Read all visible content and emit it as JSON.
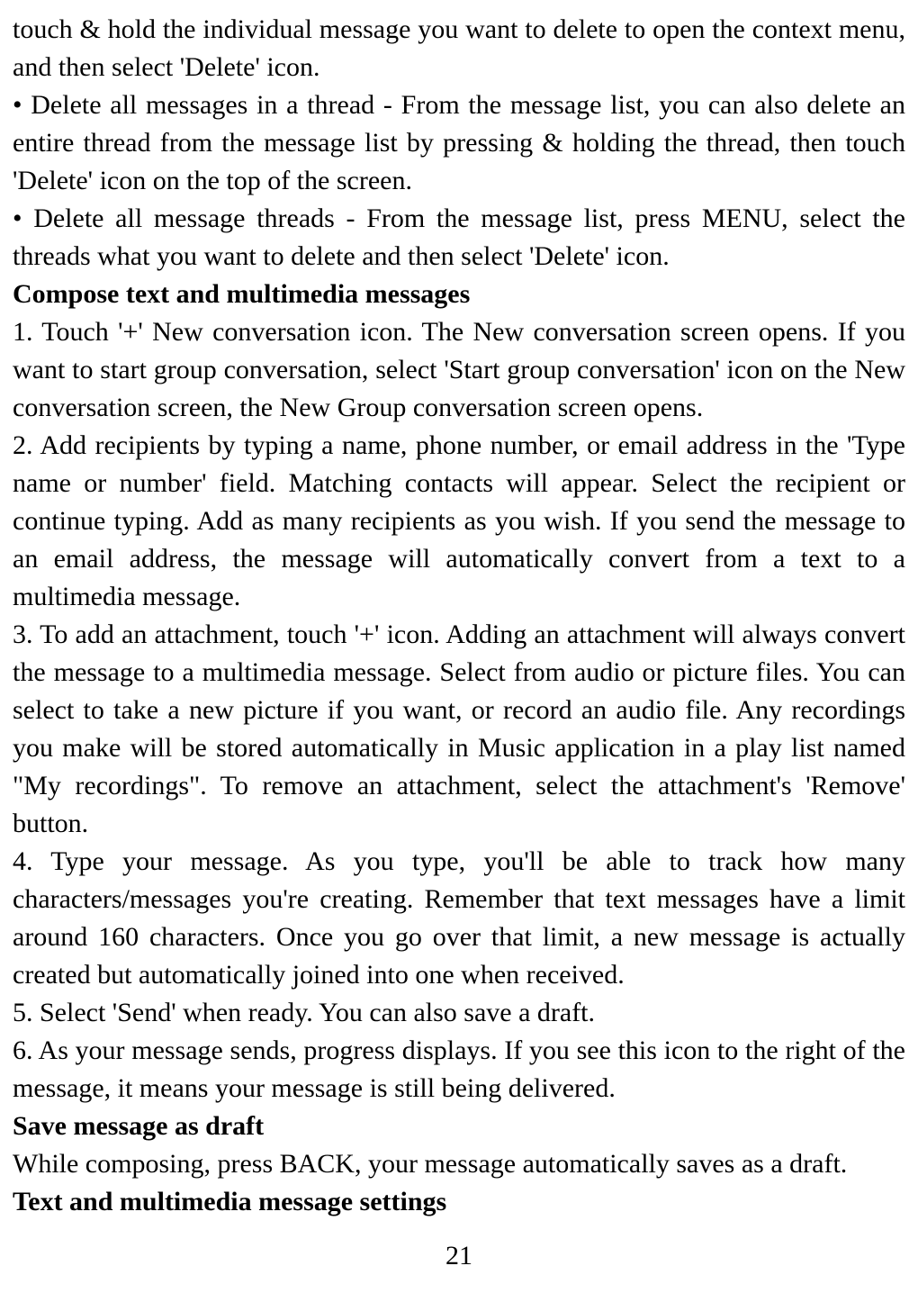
{
  "content": {
    "p1": "touch & hold the individual message you want to delete to open the context menu, and then select 'Delete' icon.",
    "p2": "• Delete all messages in a thread - From the message list, you can also delete an entire thread from the message list by pressing & holding the thread, then touch 'Delete' icon on the top of the screen.",
    "p3": "• Delete all message threads - From the message list, press MENU, select the threads what you want to delete and then select 'Delete' icon.",
    "h1": "Compose text and multimedia messages",
    "p4": "1. Touch '+' New conversation icon. The New conversation screen opens. If you want to start group conversation, select 'Start group conversation' icon on the New conversation screen, the New Group conversation screen opens.",
    "p5": "2. Add recipients by typing a name, phone number, or email address in the 'Type name or number' field. Matching contacts will appear. Select the recipient or continue typing. Add as many recipients as you wish. If you send the message to an email address, the message will automatically convert from a text to a multimedia message.",
    "p6": "3. To add an attachment, touch '+' icon. Adding an attachment will always convert the message to a multimedia message. Select from audio or picture files. You can select to take a new picture if you want, or record an audio file. Any recordings you make will be stored automatically in Music application in a play list named \"My recordings\". To remove an attachment, select the attachment's 'Remove' button.",
    "p7": "4. Type your message. As you type, you'll be able to track how many characters/messages you're creating. Remember that text messages have a limit around 160 characters. Once you go over that limit, a new message is actually created but automatically joined into one when received.",
    "p8": "5. Select 'Send' when ready. You can also save a draft.",
    "p9": "6. As your message sends, progress displays. If you see this icon to the right of the message, it means your message is still being delivered.",
    "h2": "Save message as draft",
    "p10": "While composing, press BACK, your message automatically saves as a draft.",
    "h3": "Text and multimedia message settings",
    "pageNumber": "21"
  }
}
